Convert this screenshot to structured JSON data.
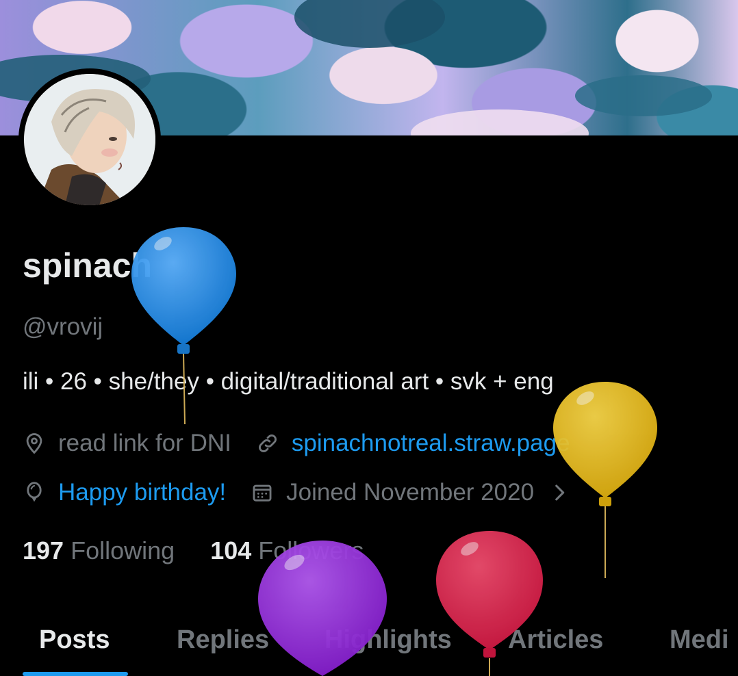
{
  "profile": {
    "display_name": "spinach",
    "handle": "@vrovij",
    "bio": "ili • 26 • she/they • digital/traditional art • svk + eng",
    "location": "read link for DNI",
    "website": "spinachnotreal.straw.page",
    "birthday_text": "Happy birthday!",
    "joined": "Joined November 2020"
  },
  "stats": {
    "following_count": "197",
    "following_label": "Following",
    "followers_count": "104",
    "followers_label": "Followers"
  },
  "tabs": [
    {
      "label": "Posts",
      "active": true
    },
    {
      "label": "Replies",
      "active": false
    },
    {
      "label": "Highlights",
      "active": false
    },
    {
      "label": "Articles",
      "active": false
    },
    {
      "label": "Medi",
      "active": false
    }
  ],
  "icons": {
    "location": "location-pin-icon",
    "website": "link-icon",
    "birthday": "balloon-icon",
    "joined": "calendar-icon",
    "expand": "chevron-right-icon"
  },
  "colors": {
    "accent": "#1d9bf0",
    "text_primary": "#e7e9ea",
    "text_secondary": "#71767b",
    "background": "#000000"
  }
}
